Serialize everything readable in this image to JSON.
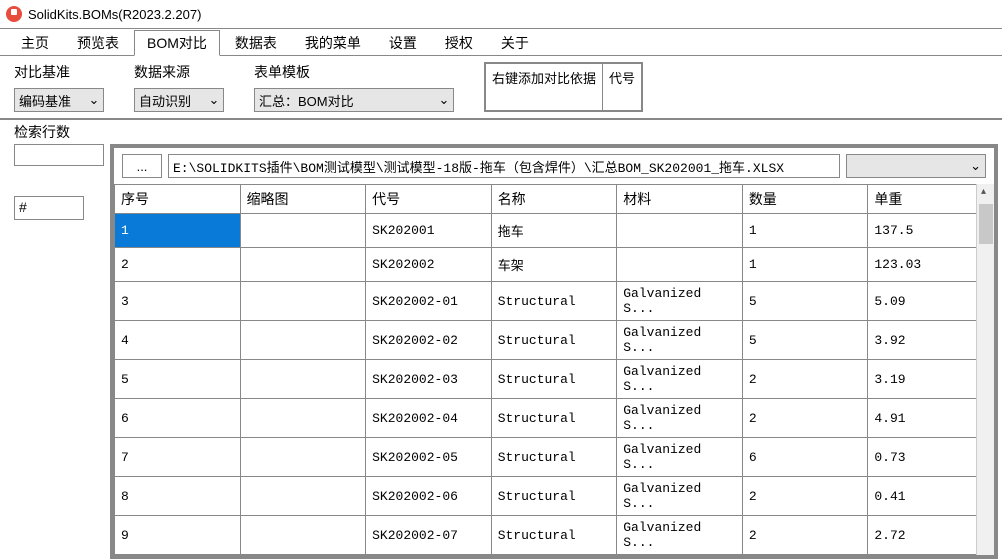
{
  "app": {
    "title": "SolidKits.BOMs(R2023.2.207)"
  },
  "menu": {
    "items": [
      {
        "label": "主页"
      },
      {
        "label": "预览表"
      },
      {
        "label": "BOM对比",
        "active": true
      },
      {
        "label": "数据表"
      },
      {
        "label": "我的菜单"
      },
      {
        "label": "设置"
      },
      {
        "label": "授权"
      },
      {
        "label": "关于"
      }
    ]
  },
  "controls": {
    "compareBasis": {
      "label": "对比基准",
      "value": "编码基准"
    },
    "dataSource": {
      "label": "数据来源",
      "value": "自动识别"
    },
    "template": {
      "label": "表单模板",
      "value": "汇总：BOM对比"
    },
    "hintLeft": "右键添加对比依据",
    "hintRight": "代号"
  },
  "searchRowsLabel": "检索行数",
  "hashLabel": "#",
  "browse": "...",
  "path": "E:\\SOLIDKITS插件\\BOM测试模型\\测试模型-18版-拖车（包含焊件）\\汇总BOM_SK202001_拖车.XLSX",
  "table": {
    "headers": [
      "序号",
      "缩略图",
      "代号",
      "名称",
      "材料",
      "数量",
      "单重"
    ],
    "rows": [
      {
        "idx": "1",
        "thumb": "",
        "code": "SK202001",
        "name": "拖车",
        "mat": "",
        "qty": "1",
        "wt": "137.5",
        "selected": true
      },
      {
        "idx": "2",
        "thumb": "",
        "code": "SK202002",
        "name": "车架",
        "mat": "",
        "qty": "1",
        "wt": "123.03"
      },
      {
        "idx": "3",
        "thumb": "",
        "code": "SK202002-01",
        "name": "Structural",
        "mat": "Galvanized S...",
        "qty": "5",
        "wt": "5.09"
      },
      {
        "idx": "4",
        "thumb": "",
        "code": "SK202002-02",
        "name": "Structural",
        "mat": "Galvanized S...",
        "qty": "5",
        "wt": "3.92"
      },
      {
        "idx": "5",
        "thumb": "",
        "code": "SK202002-03",
        "name": "Structural",
        "mat": "Galvanized S...",
        "qty": "2",
        "wt": "3.19"
      },
      {
        "idx": "6",
        "thumb": "",
        "code": "SK202002-04",
        "name": "Structural",
        "mat": "Galvanized S...",
        "qty": "2",
        "wt": "4.91"
      },
      {
        "idx": "7",
        "thumb": "",
        "code": "SK202002-05",
        "name": "Structural",
        "mat": "Galvanized S...",
        "qty": "6",
        "wt": "0.73"
      },
      {
        "idx": "8",
        "thumb": "",
        "code": "SK202002-06",
        "name": "Structural",
        "mat": "Galvanized S...",
        "qty": "2",
        "wt": "0.41"
      },
      {
        "idx": "9",
        "thumb": "",
        "code": "SK202002-07",
        "name": "Structural",
        "mat": "Galvanized S...",
        "qty": "2",
        "wt": "2.72"
      }
    ]
  }
}
